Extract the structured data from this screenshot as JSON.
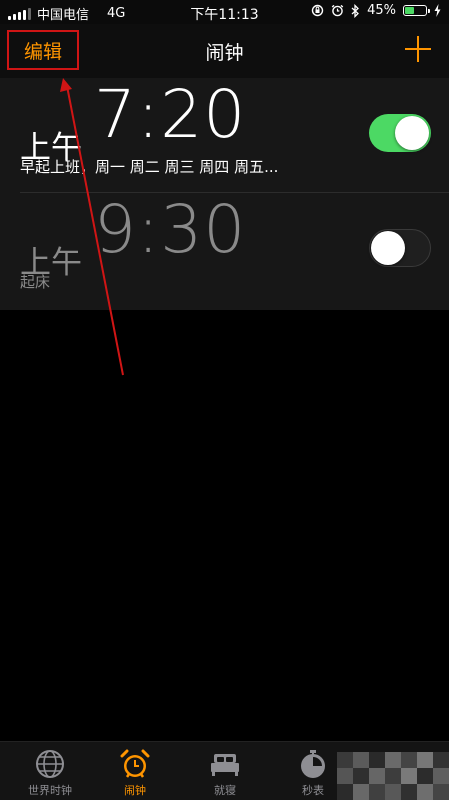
{
  "status_bar": {
    "carrier": "中国电信",
    "network": "4G",
    "time": "下午11:13",
    "battery": "45%",
    "battery_level": 0.45
  },
  "nav": {
    "edit_label": "编辑",
    "title": "闹钟"
  },
  "alarms": [
    {
      "period": "上午",
      "time": "7:20",
      "label": "早起上班，周一 周二 周三 周四 周五...",
      "enabled": true
    },
    {
      "period": "上午",
      "time": "9:30",
      "label": "起床",
      "enabled": false
    }
  ],
  "tabs": [
    {
      "label": "世界时钟",
      "icon": "globe-icon",
      "active": false
    },
    {
      "label": "闹钟",
      "icon": "alarm-clock-icon",
      "active": true
    },
    {
      "label": "就寝",
      "icon": "bed-icon",
      "active": false
    },
    {
      "label": "秒表",
      "icon": "stopwatch-icon",
      "active": false
    }
  ],
  "colors": {
    "accent": "#ff9500",
    "toggle_on": "#4cd964",
    "annotation": "#d01515"
  }
}
